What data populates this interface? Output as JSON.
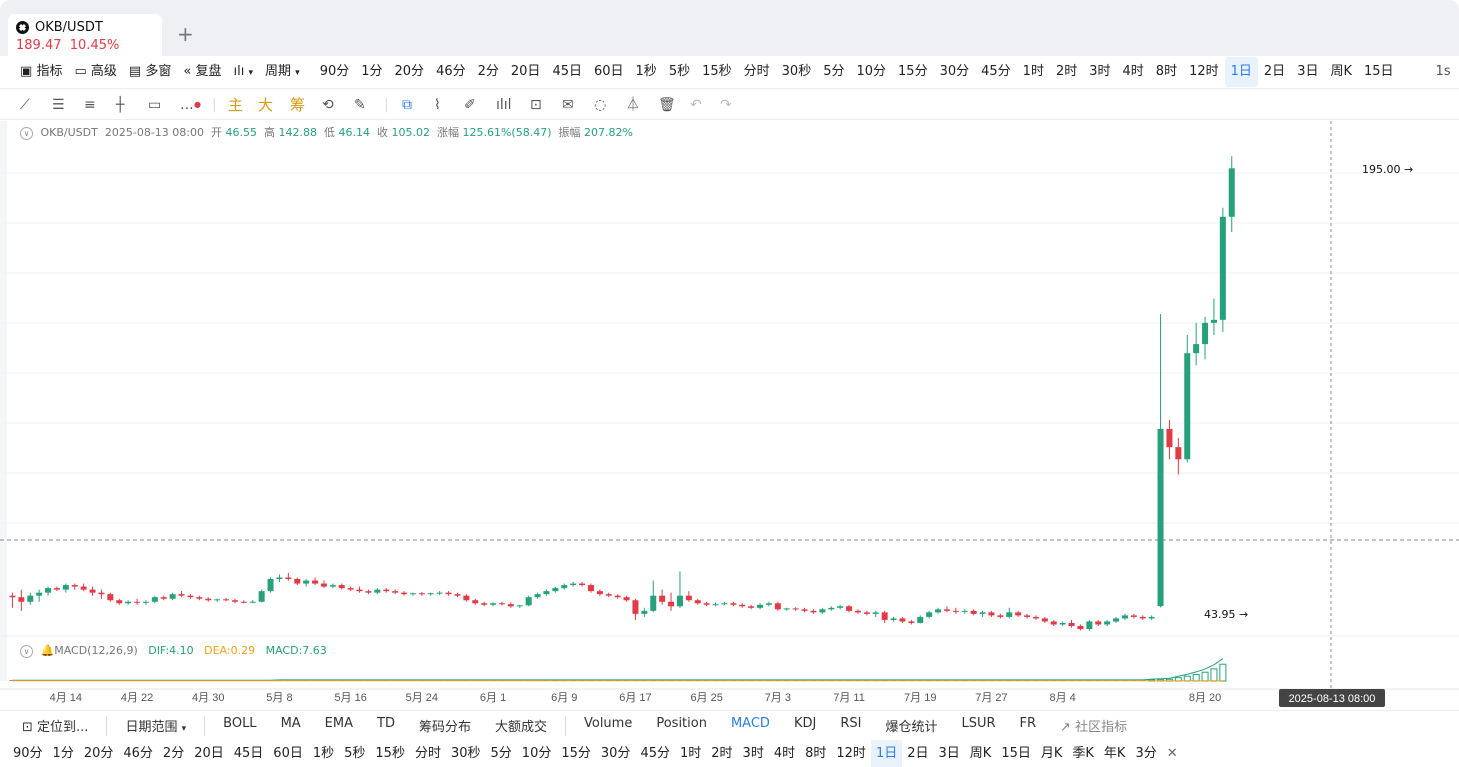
{
  "tab": {
    "symbol": "OKB/USDT",
    "price": "189.47",
    "change": "10.45%",
    "add": "+"
  },
  "toolbar1": {
    "tools": [
      "指标",
      "高级",
      "多窗",
      "复盘"
    ],
    "period_label": "周期",
    "intervals": [
      "90分",
      "1分",
      "20分",
      "46分",
      "2分",
      "20日",
      "45日",
      "60日",
      "1秒",
      "5秒",
      "15秒",
      "分时",
      "30秒",
      "5分",
      "10分",
      "15分",
      "30分",
      "45分",
      "1时",
      "2时",
      "3时",
      "4时",
      "8时",
      "12时",
      "1日",
      "2日",
      "3日",
      "周K",
      "15日"
    ],
    "selected": "1日",
    "overflow": "1s"
  },
  "toolbar2": {
    "main": "主",
    "big": "大",
    "chip": "筹"
  },
  "legend": {
    "symbol": "OKB/USDT",
    "datetime": "2025-08-13 08:00",
    "open_l": "开",
    "open": "46.55",
    "high_l": "高",
    "high": "142.88",
    "low_l": "低",
    "low": "46.14",
    "close_l": "收",
    "close": "105.02",
    "chg_l": "涨幅",
    "chg": "125.61%(58.47)",
    "amp_l": "振幅",
    "amp": "207.82%"
  },
  "macd": {
    "name": "MACD(12,26,9)",
    "dif": "DIF:4.10",
    "dea": "DEA:0.29",
    "macd": "MACD:7.63"
  },
  "price_labels": {
    "high": "195.00",
    "low": "43.95"
  },
  "xaxis": {
    "ticks": [
      "4月 14",
      "4月 22",
      "4月 30",
      "5月 8",
      "5月 16",
      "5月 24",
      "6月 1",
      "6月 9",
      "6月 17",
      "6月 25",
      "7月 3",
      "7月 11",
      "7月 19",
      "7月 27",
      "8月 4",
      "8月 20"
    ],
    "crosshair": "2025-08-13 08:00"
  },
  "toolbar3": {
    "locate": "定位到...",
    "range": "日期范围",
    "indicators": [
      "BOLL",
      "MA",
      "EMA",
      "TD",
      "筹码分布",
      "大额成交"
    ],
    "subs": [
      "Volume",
      "Position",
      "MACD",
      "KDJ",
      "RSI",
      "爆仓统计",
      "LSUR",
      "FR"
    ],
    "active": "MACD",
    "community": "社区指标"
  },
  "toolbar4": {
    "intervals": [
      "90分",
      "1分",
      "20分",
      "46分",
      "2分",
      "20日",
      "45日",
      "60日",
      "1秒",
      "5秒",
      "15秒",
      "分时",
      "30秒",
      "5分",
      "10分",
      "15分",
      "30分",
      "45分",
      "1时",
      "2时",
      "3时",
      "4时",
      "8时",
      "12时",
      "1日",
      "2日",
      "3日",
      "周K",
      "15日",
      "月K",
      "季K",
      "年K",
      "3分"
    ],
    "selected": "1日",
    "close": "✕"
  },
  "colors": {
    "up": "#26a17b",
    "down": "#e23b45",
    "accent": "#2b7de9"
  },
  "chart_data": {
    "type": "candlestick",
    "ylim": [
      40,
      200
    ],
    "dates": [
      "4月 8",
      "4月 9",
      "4月 10",
      "4月 11",
      "4月 12",
      "4月 13",
      "4月 14",
      "4月 15",
      "4月 16",
      "4月 17",
      "4月 18",
      "4月 19",
      "4月 20",
      "4月 21",
      "4月 22",
      "4月 23",
      "4月 24",
      "4月 25",
      "4月 26",
      "4月 27",
      "4月 28",
      "4月 29",
      "4月 30",
      "5月 1",
      "5月 2",
      "5月 3",
      "5月 4",
      "5月 5",
      "5月 6",
      "5月 7",
      "5月 8",
      "5月 9",
      "5月 10",
      "5月 11",
      "5月 12",
      "5月 13",
      "5月 14",
      "5月 15",
      "5月 16",
      "5月 17",
      "5月 18",
      "5月 19",
      "5月 20",
      "5月 21",
      "5月 22",
      "5月 23",
      "5月 24",
      "5月 25",
      "5月 26",
      "5月 27",
      "5月 28",
      "5月 29",
      "5月 30",
      "5月 31",
      "6月 1",
      "6月 2",
      "6月 3",
      "6月 4",
      "6月 5",
      "6月 6",
      "6月 7",
      "6月 8",
      "6月 9",
      "6月 10",
      "6月 11",
      "6月 12",
      "6月 13",
      "6月 14",
      "6月 15",
      "6月 16",
      "6月 17",
      "6月 18",
      "6月 19",
      "6月 20",
      "6月 21",
      "6月 22",
      "6月 23",
      "6月 24",
      "6月 25",
      "6月 26",
      "6月 27",
      "6月 28",
      "6月 29",
      "6月 30",
      "7月 1",
      "7月 2",
      "7月 3",
      "7月 4",
      "7月 5",
      "7月 6",
      "7月 7",
      "7月 8",
      "7月 9",
      "7月 10",
      "7月 11",
      "7月 12",
      "7月 13",
      "7月 14",
      "7月 15",
      "7月 16",
      "7月 17",
      "7月 18",
      "7月 19",
      "7月 20",
      "7月 21",
      "7月 22",
      "7月 23",
      "7月 24",
      "7月 25",
      "7月 26",
      "7月 27",
      "7月 28",
      "7月 29",
      "7月 30",
      "7月 31",
      "8月 1",
      "8月 2",
      "8月 3",
      "8月 4",
      "8月 5",
      "8月 6",
      "8月 7",
      "8月 8",
      "8月 9",
      "8月 10",
      "8月 11",
      "8月 12",
      "8月 13",
      "8月 14",
      "8月 15",
      "8月 16",
      "8月 17",
      "8月 18",
      "8月 19",
      "8月 20",
      "8月 21"
    ],
    "ohlc": [
      [
        50,
        51,
        46,
        49.5
      ],
      [
        49.5,
        52,
        45,
        48
      ],
      [
        48,
        51,
        47,
        50
      ],
      [
        50,
        52,
        48,
        51
      ],
      [
        51,
        53,
        50,
        52.5
      ],
      [
        52.5,
        53,
        51.5,
        52
      ],
      [
        52,
        54,
        51,
        53.5
      ],
      [
        53.5,
        54,
        52,
        53
      ],
      [
        53,
        54,
        51.5,
        52
      ],
      [
        52,
        53,
        50,
        51
      ],
      [
        51,
        52,
        49,
        50.5
      ],
      [
        50.5,
        51,
        48,
        48.5
      ],
      [
        48.5,
        49,
        47,
        47.5
      ],
      [
        47.5,
        48.5,
        47,
        48
      ],
      [
        48,
        49,
        47,
        47.8
      ],
      [
        47.8,
        48.5,
        47,
        48
      ],
      [
        48,
        50,
        47.5,
        49.5
      ],
      [
        49.5,
        50,
        48.5,
        49
      ],
      [
        49,
        51,
        48.5,
        50.5
      ],
      [
        50.5,
        51.5,
        49.5,
        50
      ],
      [
        50,
        50.5,
        49,
        49.5
      ],
      [
        49.5,
        50,
        48.5,
        49
      ],
      [
        49,
        49.5,
        48,
        48.5
      ],
      [
        48.5,
        49,
        48,
        48.8
      ],
      [
        48.8,
        49.2,
        48.2,
        48.5
      ],
      [
        48.5,
        49,
        47.5,
        48
      ],
      [
        48,
        48.5,
        47.5,
        47.8
      ],
      [
        47.8,
        48.5,
        47.5,
        48
      ],
      [
        48,
        52,
        47.8,
        51.5
      ],
      [
        51.5,
        56,
        51,
        55.5
      ],
      [
        55.5,
        57,
        54.5,
        56
      ],
      [
        56,
        57.5,
        55,
        55.5
      ],
      [
        55.5,
        56,
        53.5,
        54
      ],
      [
        54,
        55.5,
        53,
        55
      ],
      [
        55,
        56,
        53.5,
        54
      ],
      [
        54,
        55,
        52.5,
        53
      ],
      [
        53,
        54,
        52.5,
        53.5
      ],
      [
        53.5,
        54,
        52,
        52.5
      ],
      [
        52.5,
        53,
        51.5,
        52
      ],
      [
        52,
        53,
        51,
        51.5
      ],
      [
        51.5,
        52,
        50.5,
        51
      ],
      [
        51,
        52.5,
        50.5,
        52
      ],
      [
        52,
        52.5,
        51,
        51.5
      ],
      [
        51.5,
        52,
        50.5,
        51
      ],
      [
        51,
        51.5,
        50,
        50.5
      ],
      [
        50.5,
        51,
        50,
        50.8
      ],
      [
        50.8,
        51.2,
        50,
        50.5
      ],
      [
        50.5,
        51,
        50,
        50.8
      ],
      [
        50.8,
        51.5,
        50.2,
        51
      ],
      [
        51,
        51.5,
        50,
        50.5
      ],
      [
        50.5,
        51,
        49.5,
        50
      ],
      [
        50,
        50.5,
        48,
        48.5
      ],
      [
        48.5,
        49,
        47,
        47.5
      ],
      [
        47.5,
        48,
        46.5,
        47
      ],
      [
        47,
        47.8,
        46.5,
        47.5
      ],
      [
        47.5,
        48,
        46.8,
        47.2
      ],
      [
        47.2,
        47.8,
        46,
        46.5
      ],
      [
        46.5,
        47,
        46,
        46.8
      ],
      [
        46.8,
        50,
        46.5,
        49.5
      ],
      [
        49.5,
        51,
        49,
        50.5
      ],
      [
        50.5,
        52,
        50,
        51.5
      ],
      [
        51.5,
        53,
        51,
        52.5
      ],
      [
        52.5,
        54,
        52,
        53.5
      ],
      [
        53.5,
        54.5,
        53,
        54
      ],
      [
        54,
        54.5,
        53,
        53.5
      ],
      [
        53.5,
        54,
        51,
        51.5
      ],
      [
        51.5,
        52,
        50,
        50.5
      ],
      [
        50.5,
        51,
        49.5,
        50
      ],
      [
        50,
        50.5,
        49,
        49.5
      ],
      [
        49.5,
        50,
        48,
        48.5
      ],
      [
        48.5,
        49,
        42,
        44
      ],
      [
        44,
        46,
        43,
        45
      ],
      [
        45,
        55,
        44.5,
        50
      ],
      [
        50,
        52,
        47,
        48
      ],
      [
        48,
        51,
        45,
        46.5
      ],
      [
        46.5,
        58,
        46,
        50
      ],
      [
        50,
        51.5,
        48,
        48.5
      ],
      [
        48.5,
        49,
        47,
        47.5
      ],
      [
        47.5,
        48,
        46.5,
        47
      ],
      [
        47,
        47.8,
        46.5,
        47.2
      ],
      [
        47.2,
        48,
        46.8,
        47.5
      ],
      [
        47.5,
        48,
        46.5,
        47
      ],
      [
        47,
        47.5,
        46,
        46.5
      ],
      [
        46.5,
        47,
        45.5,
        46
      ],
      [
        46,
        47.5,
        45.5,
        47
      ],
      [
        47,
        48,
        46.5,
        47.5
      ],
      [
        47.5,
        48,
        45,
        45.5
      ],
      [
        45.5,
        46,
        45,
        45.8
      ],
      [
        45.8,
        46.2,
        45,
        45.5
      ],
      [
        45.5,
        46,
        44.5,
        45
      ],
      [
        45,
        45.5,
        44,
        44.5
      ],
      [
        44.5,
        46,
        44,
        45.5
      ],
      [
        45.5,
        46.5,
        45,
        46
      ],
      [
        46,
        47,
        45.5,
        46.5
      ],
      [
        46.5,
        47,
        44.5,
        45
      ],
      [
        45,
        45.5,
        44,
        44.5
      ],
      [
        44.5,
        45,
        43.5,
        44
      ],
      [
        44,
        45,
        43,
        44.5
      ],
      [
        44.5,
        45,
        41,
        42
      ],
      [
        42,
        43,
        41.5,
        42.5
      ],
      [
        42.5,
        43,
        41,
        41.5
      ],
      [
        41.5,
        42,
        40.5,
        41
      ],
      [
        41,
        43.5,
        40.8,
        43
      ],
      [
        43,
        45,
        42.5,
        44.5
      ],
      [
        44.5,
        46,
        44,
        45.5
      ],
      [
        45.5,
        46.5,
        44.5,
        45
      ],
      [
        45,
        46,
        44,
        44.8
      ],
      [
        44.8,
        45.5,
        44,
        45
      ],
      [
        45,
        45.5,
        43.5,
        44
      ],
      [
        44,
        45,
        43,
        44.5
      ],
      [
        44.5,
        45,
        43,
        43.5
      ],
      [
        43.5,
        44,
        42.5,
        43
      ],
      [
        43,
        46,
        42.5,
        44.5
      ],
      [
        44.5,
        45,
        43,
        43.5
      ],
      [
        43.5,
        44,
        42.5,
        43
      ],
      [
        43,
        43.5,
        42,
        42.5
      ],
      [
        42.5,
        43,
        41,
        41.5
      ],
      [
        41.5,
        42,
        40,
        40.5
      ],
      [
        40.5,
        41.5,
        40,
        41
      ],
      [
        41,
        42,
        39.5,
        40
      ],
      [
        40,
        40.5,
        38.5,
        39
      ],
      [
        39,
        42,
        38.5,
        41.5
      ],
      [
        41.5,
        42,
        40,
        40.5
      ],
      [
        40.5,
        42,
        40,
        41.5
      ],
      [
        41.5,
        43,
        41,
        42.5
      ],
      [
        42.5,
        44,
        42,
        43.5
      ],
      [
        43.5,
        44,
        42.5,
        43
      ],
      [
        43,
        43.5,
        42,
        42.5
      ],
      [
        42.5,
        43.5,
        42,
        43
      ],
      [
        46.55,
        142.88,
        46.14,
        105.02
      ],
      [
        105.02,
        108,
        95,
        99
      ],
      [
        99,
        102,
        90,
        95
      ],
      [
        95,
        136,
        94,
        130
      ],
      [
        130,
        140,
        126,
        133
      ],
      [
        133,
        142,
        128,
        140
      ],
      [
        140,
        148,
        136,
        141
      ],
      [
        141,
        178,
        137,
        175
      ],
      [
        175,
        195,
        170,
        191
      ]
    ],
    "macd_hist": [
      0.1,
      0.1,
      0.1,
      0.1,
      0.1,
      0.1,
      0.1,
      0.1,
      0.1,
      0.1,
      0.1,
      0.1,
      0.1,
      0.1,
      0.1,
      0.1,
      0.1,
      0.1,
      0.1,
      0.1,
      0.1,
      0.1,
      0.1,
      0.1,
      0.1,
      0.1,
      0.1,
      0.1,
      0.1,
      0.1,
      0.2,
      0.2,
      0.2,
      0.2,
      0.2,
      0.2,
      0.2,
      0.2,
      0.2,
      0.2,
      0.2,
      0.2,
      0.2,
      0.2,
      0.2,
      0.2,
      0.2,
      0.2,
      0.2,
      0.2,
      0.2,
      0.2,
      0.2,
      0.2,
      0.2,
      0.2,
      0.2,
      0.2,
      0.2,
      0.2,
      0.2,
      0.2,
      0.2,
      0.2,
      0.2,
      0.2,
      0.2,
      0.2,
      0.2,
      0.2,
      0.2,
      0.2,
      0.2,
      0.2,
      0.2,
      0.2,
      0.2,
      0.2,
      0.2,
      0.2,
      0.2,
      0.2,
      0.2,
      0.2,
      0.2,
      0.2,
      0.2,
      0.2,
      0.2,
      0.2,
      0.2,
      0.2,
      0.2,
      0.2,
      0.2,
      0.2,
      0.2,
      0.2,
      0.2,
      0.2,
      0.2,
      0.2,
      0.2,
      0.2,
      0.2,
      0.2,
      0.2,
      0.2,
      0.2,
      0.2,
      0.2,
      0.2,
      0.2,
      0.2,
      0.2,
      0.2,
      0.2,
      0.2,
      0.2,
      0.2,
      0.2,
      0.2,
      0.2,
      0.2,
      0.2,
      0.2,
      0.2,
      0.2,
      0.5,
      0.6,
      0.8,
      1.5,
      2.2,
      3,
      4,
      5.5,
      7.63
    ]
  }
}
